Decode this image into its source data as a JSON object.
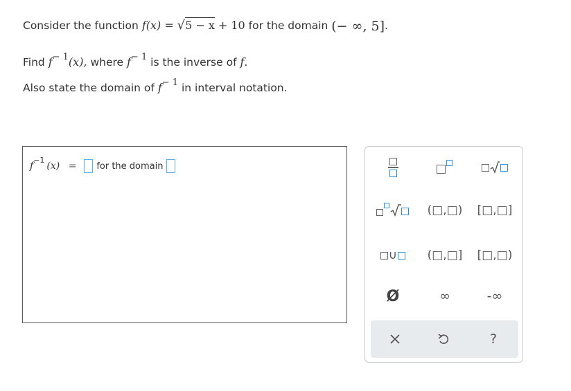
{
  "question": {
    "line1_prefix": "Consider the function",
    "func_lhs": "f(x) =",
    "radicand": "5 − x",
    "plus_term": "+ 10",
    "domain_text": "for the domain",
    "domain_interval": "(− ∞, 5]",
    "period": ".",
    "line2_find": "Find",
    "inv_sup": "− 1",
    "inv_arg": "(x),",
    "line2_where": "where",
    "line2_is_inverse": "is the inverse of",
    "f_letter": "f",
    "line3_prefix": "Also state the domain of",
    "line3_suffix": "in interval notation."
  },
  "answer": {
    "lhs_f": "f",
    "lhs_sup": "−1",
    "lhs_arg": "(x)",
    "equals": "=",
    "for_domain": "for the domain"
  },
  "palette": {
    "interval_open_open": "(□,□)",
    "interval_closed_closed": "[□,□]",
    "interval_open_closed": "(□,□]",
    "interval_closed_open": "[□,□)",
    "union": "∪",
    "empty_set": "Ø",
    "infinity": "∞",
    "neg_infinity": "-∞",
    "help": "?",
    "accent_color": "#2f8fd8"
  }
}
